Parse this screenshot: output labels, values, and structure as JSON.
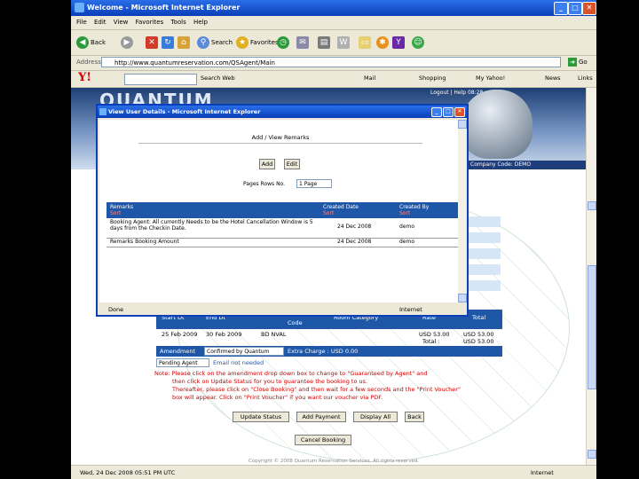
{
  "window": {
    "title": "Welcome - Microsoft Internet Explorer"
  },
  "menu": [
    "File",
    "Edit",
    "View",
    "Favorites",
    "Tools",
    "Help"
  ],
  "toolbar": {
    "back": "Back",
    "search": "Search",
    "favorites": "Favorites"
  },
  "address": {
    "label": "Address",
    "url": "http://www.quantumreservation.com/QSAgent/Main",
    "go": "Go"
  },
  "yahoo": {
    "logo": "Y!",
    "search_button": "Search Web",
    "items": [
      "Mail",
      "Shopping",
      "My Yahoo!",
      "News"
    ],
    "links": "Links"
  },
  "page": {
    "brand": "QUANTUM",
    "logout": "Logout | Help 08:28",
    "company_code": "Company Code: DEMO",
    "table_headers": [
      "Start Dt",
      "End Dt",
      "Code",
      "Room Category",
      "Rate",
      "Total"
    ],
    "rows": [
      {
        "start": "25 Feb 2009",
        "end": "30 Feb 2009",
        "code": "BD NVAL",
        "category": "",
        "rate": "USD 53.00",
        "total": "USD 53.00"
      }
    ],
    "total_label": "Total :",
    "total_value": "USD 53.00",
    "amendment_label": "Amendment",
    "amendment_value": "Confirmed by Quantum",
    "extra_charge": "Extra Charge : USD 0.00",
    "agent_select": "Pending Agent",
    "email_note": "Email not needed",
    "note": [
      "Note: Please click on the amendment drop down box to change to \"Guaranteed by Agent\" and",
      "then click on Update Status for you to guarantee the booking to us.",
      "Thereafter, please click on \"Close Booking\" and then wait for a few seconds and the \"Print Voucher\"",
      "box will appear. Click on \"Print Voucher\" if you want our voucher via PDF."
    ],
    "buttons": [
      "Update Status",
      "Add Payment",
      "Display All",
      "Back"
    ],
    "cancel_button": "Cancel Booking",
    "footer": "Copyright © 2008 Quantum Reservation Services. All rights reserved."
  },
  "popup": {
    "title": "View User Details - Microsoft Internet Explorer",
    "heading": "Add / View Remarks",
    "add": "Add",
    "edit": "Edit",
    "rows_per_page_label": "Pages Rows No.",
    "rows_per_page_value": "1 Page",
    "col_remarks": "Remarks",
    "col_created_date": "Created Date",
    "col_created_by": "Created By",
    "sort_label": "Sort",
    "rows": [
      {
        "remarks": "Booking Agent: All currently Needs to be the Hotel Cancellation Window is 5 days from the Checkin Date.",
        "date": "24 Dec 2008",
        "by": "demo"
      },
      {
        "remarks": "Remarks Booking Amount",
        "date": "24 Dec 2008",
        "by": "demo"
      }
    ],
    "status": "Done",
    "zone": "Internet"
  },
  "statusbar": {
    "text": "Wed, 24 Dec 2008 05:51 PM UTC",
    "zone": "Internet"
  }
}
